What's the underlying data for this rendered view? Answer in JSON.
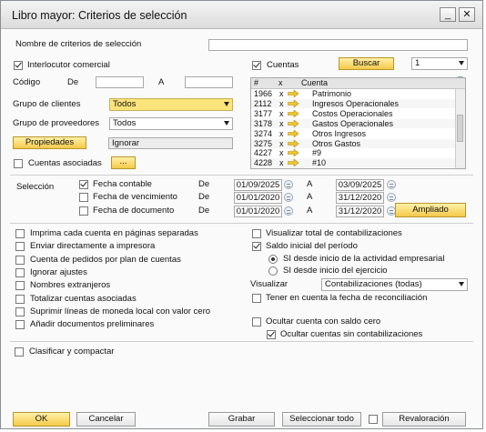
{
  "window": {
    "title": "Libro mayor: Criterios de selección",
    "minimize": "_",
    "close": "✕"
  },
  "criteria_name": {
    "label": "Nombre de criterios de selección",
    "value": ""
  },
  "partner": {
    "checkbox_label": "Interlocutor comercial",
    "code_label": "Código",
    "from_label": "De",
    "to_label": "A",
    "from_value": "",
    "to_value": "",
    "customer_group_label": "Grupo de clientes",
    "customer_group_value": "Todos",
    "supplier_group_label": "Grupo de proveedores",
    "supplier_group_value": "Todos",
    "properties_button": "Propiedades",
    "properties_value": "Ignorar",
    "associated_accounts_label": "Cuentas asociadas",
    "associated_accounts_button": "..."
  },
  "accounts": {
    "checkbox_label": "Cuentas",
    "search_button": "Buscar",
    "level_value": "1",
    "table_headers": [
      "#",
      "x",
      "Cuenta"
    ],
    "rows": [
      {
        "code": "1966",
        "x": "x",
        "name": "Patrimonio"
      },
      {
        "code": "2112",
        "x": "x",
        "name": "Ingresos Operacionales"
      },
      {
        "code": "3177",
        "x": "x",
        "name": "Costos Operacionales"
      },
      {
        "code": "3178",
        "x": "x",
        "name": "Gastos Operacionales"
      },
      {
        "code": "3274",
        "x": "x",
        "name": "Otros Ingresos"
      },
      {
        "code": "3275",
        "x": "x",
        "name": "Otros Gastos"
      },
      {
        "code": "4227",
        "x": "x",
        "name": "#9"
      },
      {
        "code": "4228",
        "x": "x",
        "name": "#10"
      }
    ]
  },
  "selection": {
    "label": "Selección",
    "rows": [
      {
        "label": "Fecha contable",
        "checked": true,
        "from_label": "De",
        "from": "01/09/2025",
        "to_label": "A",
        "to": "03/09/2025"
      },
      {
        "label": "Fecha de vencimiento",
        "checked": false,
        "from_label": "De",
        "from": "01/01/2020",
        "to_label": "A",
        "to": "31/12/2020"
      },
      {
        "label": "Fecha de documento",
        "checked": false,
        "from_label": "De",
        "from": "01/01/2020",
        "to_label": "A",
        "to": "31/12/2020"
      }
    ],
    "expanded_button": "Ampliado"
  },
  "options_left": [
    {
      "label": "Imprima cada cuenta en páginas separadas",
      "checked": false
    },
    {
      "label": "Enviar directamente a impresora",
      "checked": false
    },
    {
      "label": "Cuenta de pedidos por plan de cuentas",
      "checked": false
    },
    {
      "label": "Ignorar ajustes",
      "checked": false
    },
    {
      "label": "Nombres extranjeros",
      "checked": false
    },
    {
      "label": "Totalizar cuentas asociadas",
      "checked": false
    },
    {
      "label": "Suprimir líneas de moneda local con valor cero",
      "checked": false
    },
    {
      "label": "Añadir documentos preliminares",
      "checked": false
    }
  ],
  "options_right": {
    "show_total": {
      "label": "Visualizar total de contabilizaciones",
      "checked": false
    },
    "opening_balance": {
      "label": "Saldo inicial del período",
      "checked": true
    },
    "radio_company": {
      "label": "SI desde inicio de la actividad empresarial",
      "selected": true
    },
    "radio_fiscal": {
      "label": "SI desde inicio del ejercicio",
      "selected": false
    },
    "display_label": "Visualizar",
    "display_value": "Contabilizaciones (todas)",
    "reconciliation": {
      "label": "Tener en cuenta la fecha de reconciliación",
      "checked": false
    },
    "hide_zero": {
      "label": "Ocultar cuenta con saldo cero",
      "checked": false
    },
    "hide_no_postings": {
      "label": "Ocultar cuentas sin contabilizaciones",
      "checked": true
    }
  },
  "sort_compact": {
    "label": "Clasificar y compactar",
    "checked": false
  },
  "footer": {
    "ok": "OK",
    "cancel": "Cancelar",
    "save": "Grabar",
    "select_all": "Seleccionar todo",
    "revaluation": "Revaloración"
  }
}
